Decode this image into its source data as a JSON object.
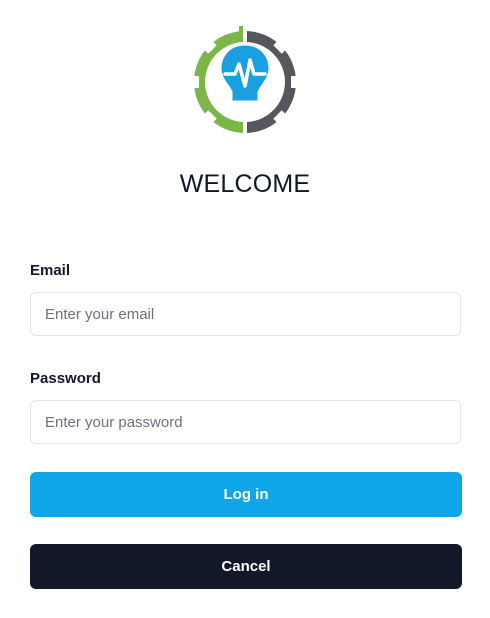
{
  "logo": {
    "icon": "lightbulb-gear-icon",
    "colors": {
      "left": "#7ab648",
      "right": "#55575d",
      "bulb": "#1a9fe0"
    }
  },
  "header": {
    "title": "WELCOME"
  },
  "form": {
    "email": {
      "label": "Email",
      "placeholder": "Enter your email",
      "value": ""
    },
    "password": {
      "label": "Password",
      "placeholder": "Enter your password",
      "value": ""
    }
  },
  "actions": {
    "login_label": "Log in",
    "cancel_label": "Cancel"
  },
  "colors": {
    "primary": "#0ea5e9",
    "dark": "#111827"
  }
}
